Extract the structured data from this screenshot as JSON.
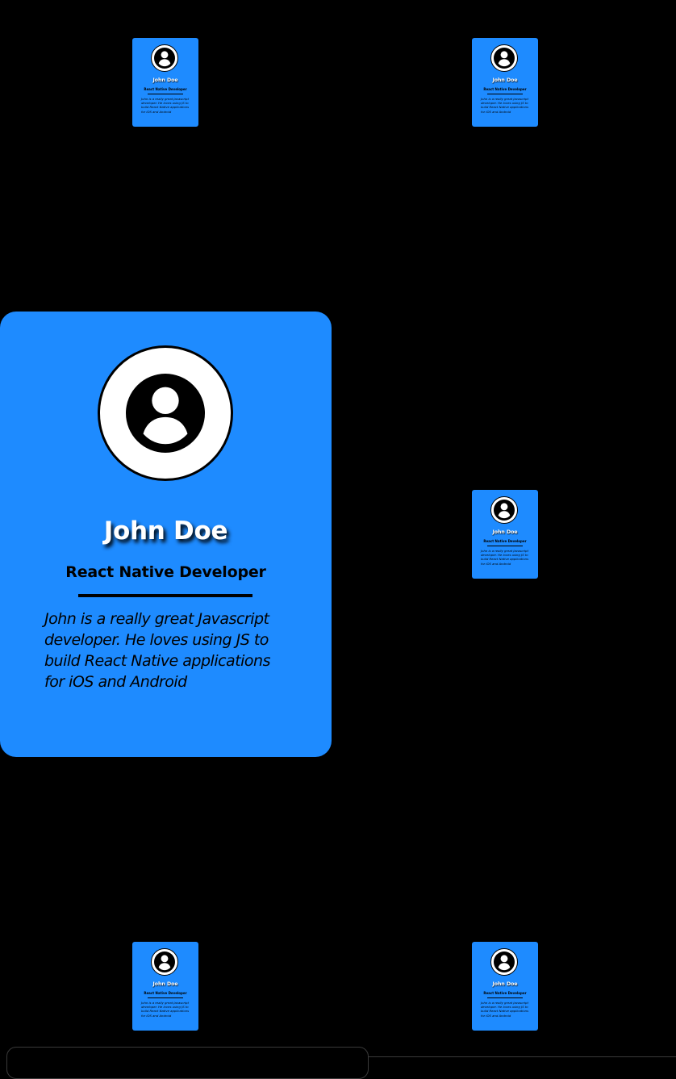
{
  "profile": {
    "name": "John Doe",
    "role": "React Native Developer",
    "bio": "John is a really great Javascript developer. He loves using JS to build React Native applications for iOS and Android",
    "avatar_icon": "user-circle-icon"
  },
  "colors": {
    "background": "#000000",
    "card": "#1e8bff",
    "name_text": "#ffffff",
    "role_text": "#000000"
  }
}
